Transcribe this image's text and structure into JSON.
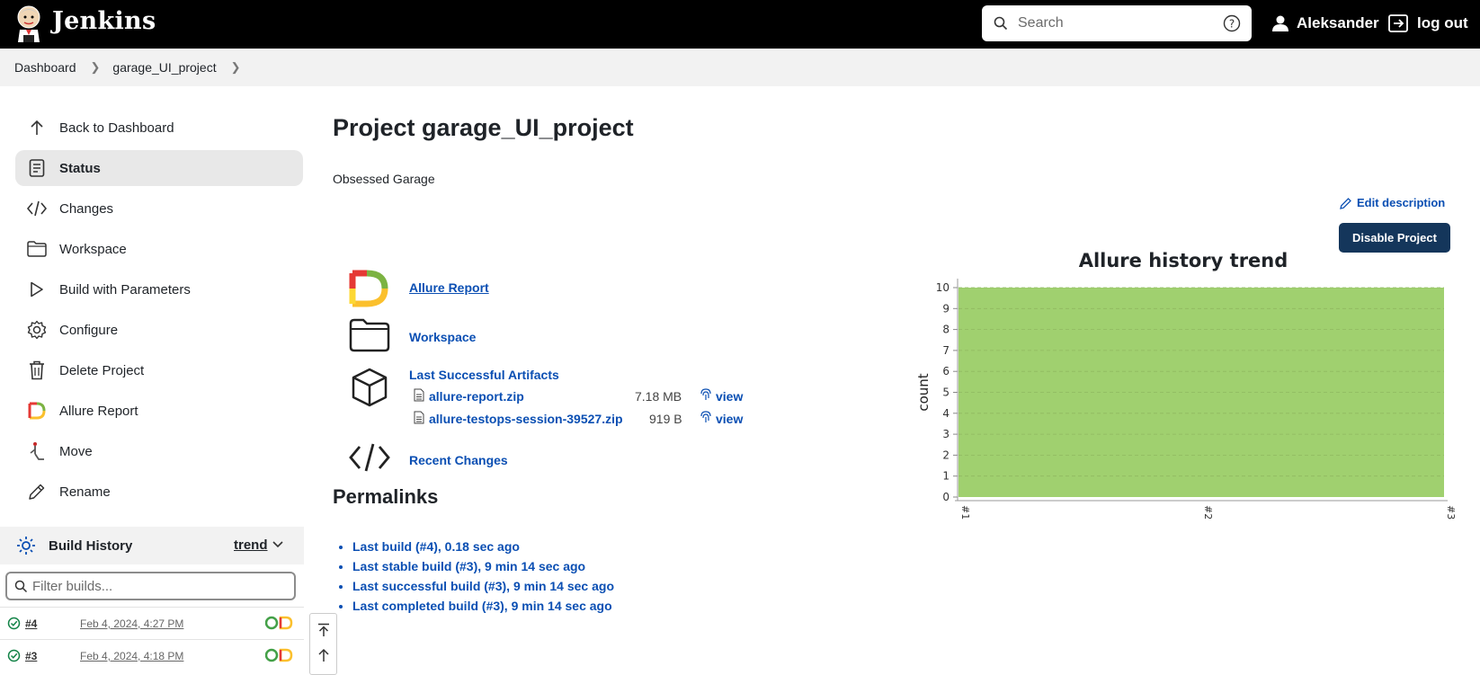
{
  "header": {
    "brand": "Jenkins",
    "search_placeholder": "Search",
    "user": "Aleksander",
    "logout": "log out"
  },
  "breadcrumb": [
    "Dashboard",
    "garage_UI_project"
  ],
  "sidebar": {
    "tasks": [
      {
        "label": "Back to Dashboard",
        "icon": "arrow-up-icon"
      },
      {
        "label": "Status",
        "icon": "status-icon",
        "active": true
      },
      {
        "label": "Changes",
        "icon": "code-icon"
      },
      {
        "label": "Workspace",
        "icon": "folder-icon"
      },
      {
        "label": "Build with Parameters",
        "icon": "play-icon"
      },
      {
        "label": "Configure",
        "icon": "gear-icon"
      },
      {
        "label": "Delete Project",
        "icon": "trash-icon"
      },
      {
        "label": "Allure Report",
        "icon": "allure-icon"
      },
      {
        "label": "Move",
        "icon": "move-icon"
      },
      {
        "label": "Rename",
        "icon": "pencil-icon"
      }
    ],
    "build_history": {
      "title": "Build History",
      "trend": "trend",
      "filter_placeholder": "Filter builds...",
      "builds": [
        {
          "num": "#4",
          "date": "Feb 4, 2024, 4:27 PM"
        },
        {
          "num": "#3",
          "date": "Feb 4, 2024, 4:18 PM"
        }
      ]
    }
  },
  "main": {
    "title": "Project garage_UI_project",
    "description": "Obsessed Garage",
    "edit_description": "Edit description",
    "disable_button": "Disable Project",
    "links": {
      "allure": "Allure Report",
      "workspace": "Workspace",
      "artifacts": "Last Successful Artifacts",
      "recent": "Recent Changes"
    },
    "artifacts": [
      {
        "name": "allure-report.zip",
        "size": "7.18 MB",
        "view": "view"
      },
      {
        "name": "allure-testops-session-39527.zip",
        "size": "919 B",
        "view": "view"
      }
    ],
    "permalinks_title": "Permalinks",
    "permalinks": [
      "Last build (#4), 0.18 sec ago",
      "Last stable build (#3), 9 min 14 sec ago",
      "Last successful build (#3), 9 min 14 sec ago",
      "Last completed build (#3), 9 min 14 sec ago"
    ]
  },
  "colors": {
    "header_bg": "#000000",
    "link": "#0b4fb3",
    "button_bg": "#14365b",
    "chart_fill": "#a0d06f"
  },
  "chart_data": {
    "type": "area",
    "title": "Allure history trend",
    "ylabel": "count",
    "xlabel": "",
    "x": [
      "#1",
      "#2",
      "#3"
    ],
    "series": [
      {
        "values": [
          10,
          10,
          10
        ]
      }
    ],
    "ylim": [
      0,
      10
    ],
    "yticks": [
      "0",
      "1",
      "2",
      "3",
      "4",
      "5",
      "6",
      "7",
      "8",
      "9",
      "10"
    ],
    "grid": true
  }
}
